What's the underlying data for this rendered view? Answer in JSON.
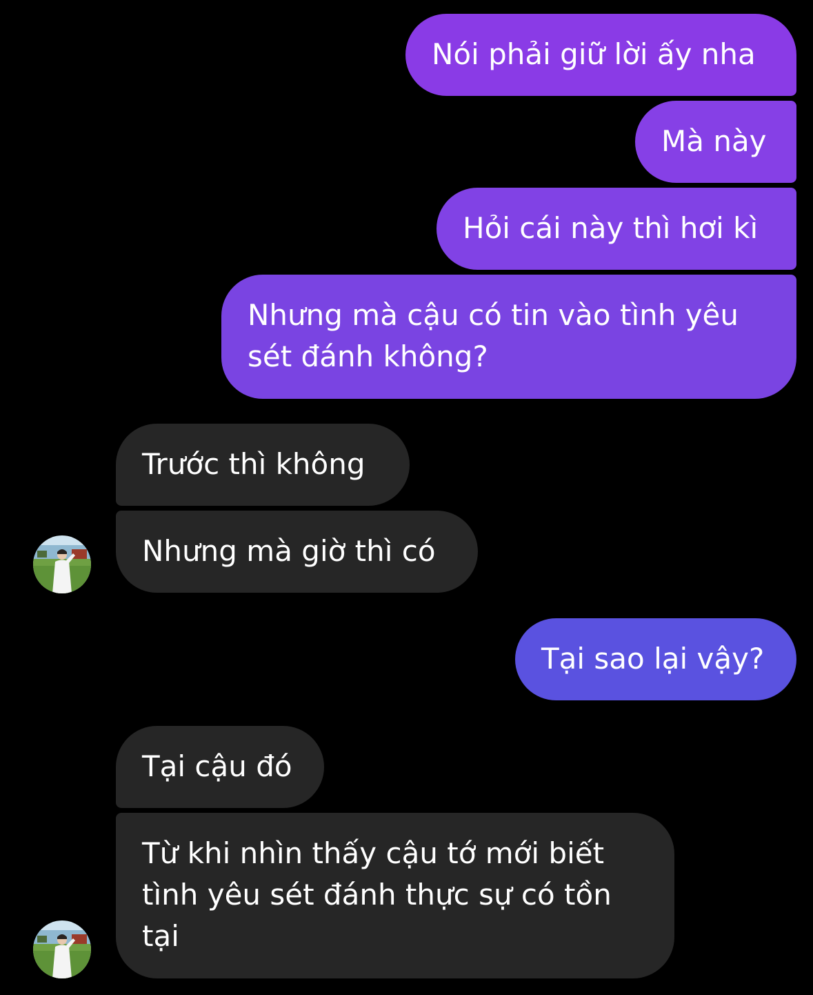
{
  "conversation": {
    "messages": [
      {
        "sender": "me",
        "text": "Nói phải giữ lời ấy nha"
      },
      {
        "sender": "me",
        "text": "Mà này"
      },
      {
        "sender": "me",
        "text": "Hỏi cái này thì hơi kì"
      },
      {
        "sender": "me",
        "text": "Nhưng mà cậu có tin vào tình yêu sét đánh không?"
      },
      {
        "sender": "them",
        "text": "Trước thì không"
      },
      {
        "sender": "them",
        "text": "Nhưng mà giờ thì có"
      },
      {
        "sender": "me",
        "text": "Tại sao lại vậy?"
      },
      {
        "sender": "them",
        "text": "Tại cậu đó"
      },
      {
        "sender": "them",
        "text": "Từ khi nhìn thấy cậu tớ mới biết tình yêu sét đánh thực sự có tồn tại"
      }
    ]
  },
  "avatar": {
    "icon": "profile-photo-avatar"
  },
  "colors": {
    "background": "#000000",
    "outgoing_top": "#8a3be6",
    "outgoing_mid": "#7a44e2",
    "outgoing_bottom": "#5a52e0",
    "incoming": "#262626",
    "text": "#ffffff"
  }
}
